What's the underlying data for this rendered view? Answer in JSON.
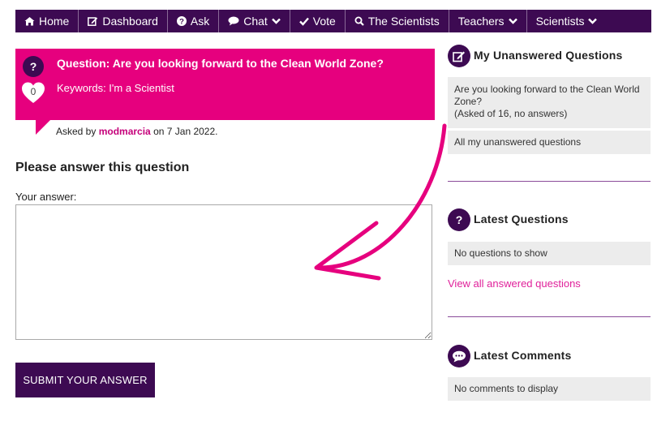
{
  "nav": {
    "items": [
      {
        "label": "Home",
        "icon": "home-icon"
      },
      {
        "label": "Dashboard",
        "icon": "edit-icon"
      },
      {
        "label": "Ask",
        "icon": "question-circle-icon"
      },
      {
        "label": "Chat",
        "icon": "chat-bubble-icon",
        "dropdown": true
      },
      {
        "label": "Vote",
        "icon": "check-icon"
      },
      {
        "label": "The Scientists",
        "icon": "search-icon"
      },
      {
        "label": "Teachers",
        "dropdown": true
      },
      {
        "label": "Scientists",
        "dropdown": true
      }
    ]
  },
  "question": {
    "title": "Question: Are you looking forward to the Clean World Zone?",
    "keywords": "Keywords: I'm a Scientist",
    "likes": "0",
    "asked_prefix": "Asked by",
    "author": "modmarcia",
    "asked_suffix": "on 7 Jan 2022."
  },
  "answer": {
    "heading": "Please answer this question",
    "label": "Your answer:",
    "value": "",
    "submit_label": "SUBMIT YOUR ANSWER"
  },
  "sidebar": {
    "unanswered": {
      "heading": "My Unanswered Questions",
      "item_text": "Are you looking forward to the Clean World Zone?",
      "item_meta": "(Asked of 16, no answers)",
      "all_link": "All my unanswered questions"
    },
    "latest_questions": {
      "heading": "Latest Questions",
      "empty": "No questions to show",
      "link": "View all answered questions"
    },
    "latest_comments": {
      "heading": "Latest Comments",
      "empty": "No comments to display"
    }
  },
  "colors": {
    "brand_purple": "#3d0a52",
    "brand_pink": "#e6007e",
    "link_pink": "#e0209a"
  }
}
